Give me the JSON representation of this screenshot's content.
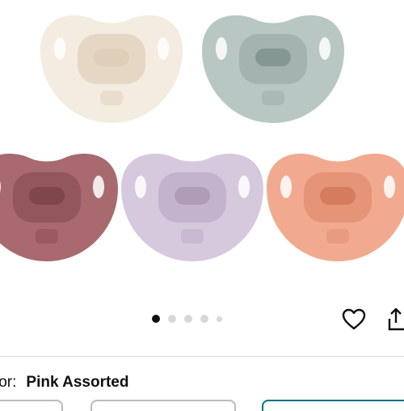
{
  "product": {
    "images": [
      {
        "name": "cream-pacifier",
        "color": "#f4ece1",
        "shade": "#e6d7c5",
        "hole": "#d8c6b0"
      },
      {
        "name": "sage-pacifier",
        "color": "#b9c7c4",
        "shade": "#a3b3b0",
        "hole": "#6e7f7c"
      },
      {
        "name": "rose-pacifier",
        "color": "#a86a6e",
        "shade": "#93565b",
        "hole": "#6f3a3f"
      },
      {
        "name": "lilac-pacifier",
        "color": "#d7c9dd",
        "shade": "#c4b3cc",
        "hole": "#9e8aa6"
      },
      {
        "name": "peach-pacifier",
        "color": "#f1aa8f",
        "shade": "#e69477",
        "hole": "#c8684a"
      }
    ],
    "carousel": {
      "count": 5,
      "active_index": 0
    },
    "color_label": "lor:",
    "color_value": "Pink Assorted"
  }
}
